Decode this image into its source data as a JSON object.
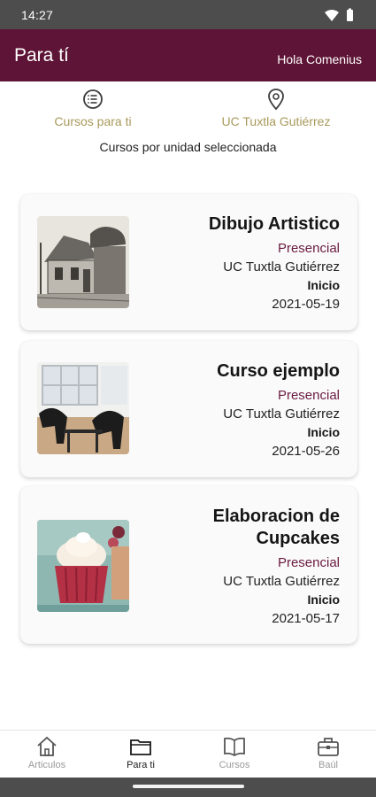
{
  "status_bar": {
    "time": "14:27",
    "icons": [
      "wifi-icon",
      "battery-icon"
    ]
  },
  "app_bar": {
    "title": "Para tí",
    "greeting": "Hola Comenius"
  },
  "filters": {
    "courses_label": "Cursos para ti",
    "courses_icon": "list-icon",
    "unit_label": "UC Tuxtla Gutiérrez",
    "unit_icon": "location-pin-icon",
    "subtitle": "Cursos por unidad seleccionada"
  },
  "courses": [
    {
      "title": "Dibujo Artistico",
      "mode": "Presencial",
      "unit": "UC Tuxtla Gutiérrez",
      "start_label": "Inicio",
      "date": "2021-05-19",
      "image": "sketch-house-image"
    },
    {
      "title": "Curso ejemplo",
      "mode": "Presencial",
      "unit": "UC Tuxtla Gutiérrez",
      "start_label": "Inicio",
      "date": "2021-05-26",
      "image": "office-chairs-image"
    },
    {
      "title": "Elaboracion de Cupcakes",
      "mode": "Presencial",
      "unit": "UC Tuxtla Gutiérrez",
      "start_label": "Inicio",
      "date": "2021-05-17",
      "image": "cupcake-image"
    }
  ],
  "bottom_nav": {
    "items": [
      {
        "label": "Articulos",
        "icon": "home-icon",
        "active": false
      },
      {
        "label": "Para ti",
        "icon": "folder-icon",
        "active": true
      },
      {
        "label": "Cursos",
        "icon": "book-icon",
        "active": false
      },
      {
        "label": "Baúl",
        "icon": "briefcase-icon",
        "active": false
      }
    ]
  },
  "colors": {
    "primary": "#5e1436",
    "accent": "#a8995a",
    "system_bar": "#4d4d4d"
  }
}
